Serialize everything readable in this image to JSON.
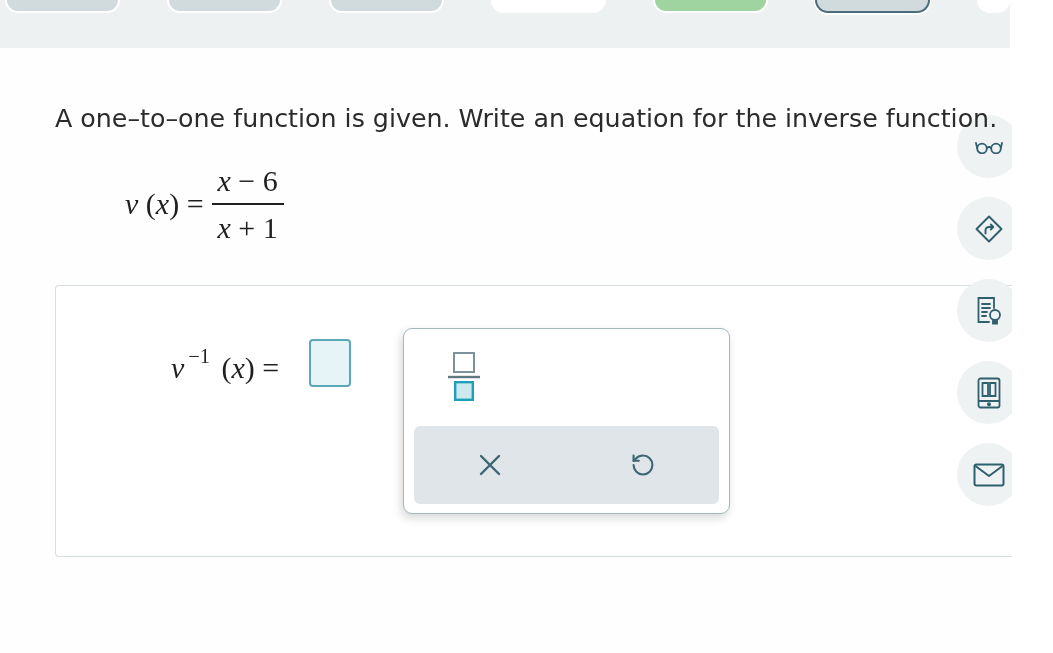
{
  "progress_steps": [
    {
      "color": "#d1dadd",
      "selected": false
    },
    {
      "color": "#d1dadd",
      "selected": false
    },
    {
      "color": "#d1dadd",
      "selected": false
    },
    {
      "color": "#ffffff",
      "selected": false
    },
    {
      "color": "#9fd4a0",
      "selected": false
    },
    {
      "color": "#d1dadd",
      "selected": true
    },
    {
      "color": "#ffffff",
      "selected": false
    }
  ],
  "question": "A one–to–one function is given. Write an equation for the inverse function.",
  "given_function": {
    "lhs": "*v* (*x*) =",
    "numerator": "*x* − 6",
    "denominator": "*x* + 1"
  },
  "answer": {
    "lhs": "*v*$^{−1}$ (*x*) =",
    "focused": true
  }
}
